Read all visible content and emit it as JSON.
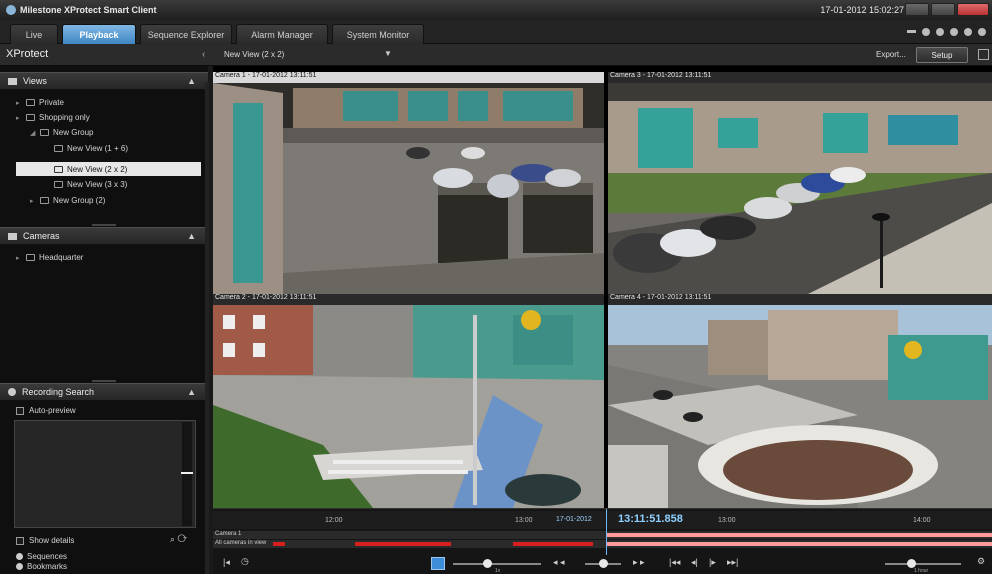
{
  "titlebar": {
    "title": "Milestone XProtect Smart Client",
    "clock": "17-01-2012 15:02:27"
  },
  "tabs": [
    {
      "label": "Live"
    },
    {
      "label": "Playback"
    },
    {
      "label": "Sequence Explorer"
    },
    {
      "label": "Alarm Manager"
    },
    {
      "label": "System Monitor"
    }
  ],
  "viewbar": {
    "brand": "XProtect",
    "view_name": "New View (2 x 2)",
    "export_label": "Export...",
    "setup_label": "Setup"
  },
  "views_panel": {
    "title": "Views",
    "items": [
      {
        "label": "Private"
      },
      {
        "label": "Shopping only"
      },
      {
        "label": "New Group"
      },
      {
        "label": "New View (1 + 6)"
      },
      {
        "label": "New View (2 x 2)"
      },
      {
        "label": "New View (3 x 3)"
      },
      {
        "label": "New Group (2)"
      }
    ]
  },
  "cameras_panel": {
    "title": "Cameras",
    "items": [
      {
        "label": "Headquarter"
      }
    ]
  },
  "recording_panel": {
    "title": "Recording Search",
    "auto_preview": "Auto-preview",
    "show_details": "Show details",
    "options": [
      "Sequences",
      "Bookmarks"
    ]
  },
  "cameras": [
    {
      "title": "Camera 1 - 17-01-2012 13:11:51"
    },
    {
      "title": "Camera 3 - 17-01-2012 13:11:51"
    },
    {
      "title": "Camera 2 - 17-01-2012 13:11:51"
    },
    {
      "title": "Camera 4 - 17-01-2012 13:11:51"
    }
  ],
  "timeline": {
    "ticks": [
      "12:00",
      "13:00",
      "13:00",
      "14:00"
    ],
    "current_date": "17-01-2012",
    "current_time": "13:11:51.858",
    "track1_label": "Camera 1",
    "track2_label": "All cameras in view",
    "speed_label": "1x",
    "span_label": "1 hour"
  },
  "colors": {
    "accent": "#3f86c3",
    "recording": "#d6201f",
    "timecode": "#8fd0ff"
  }
}
